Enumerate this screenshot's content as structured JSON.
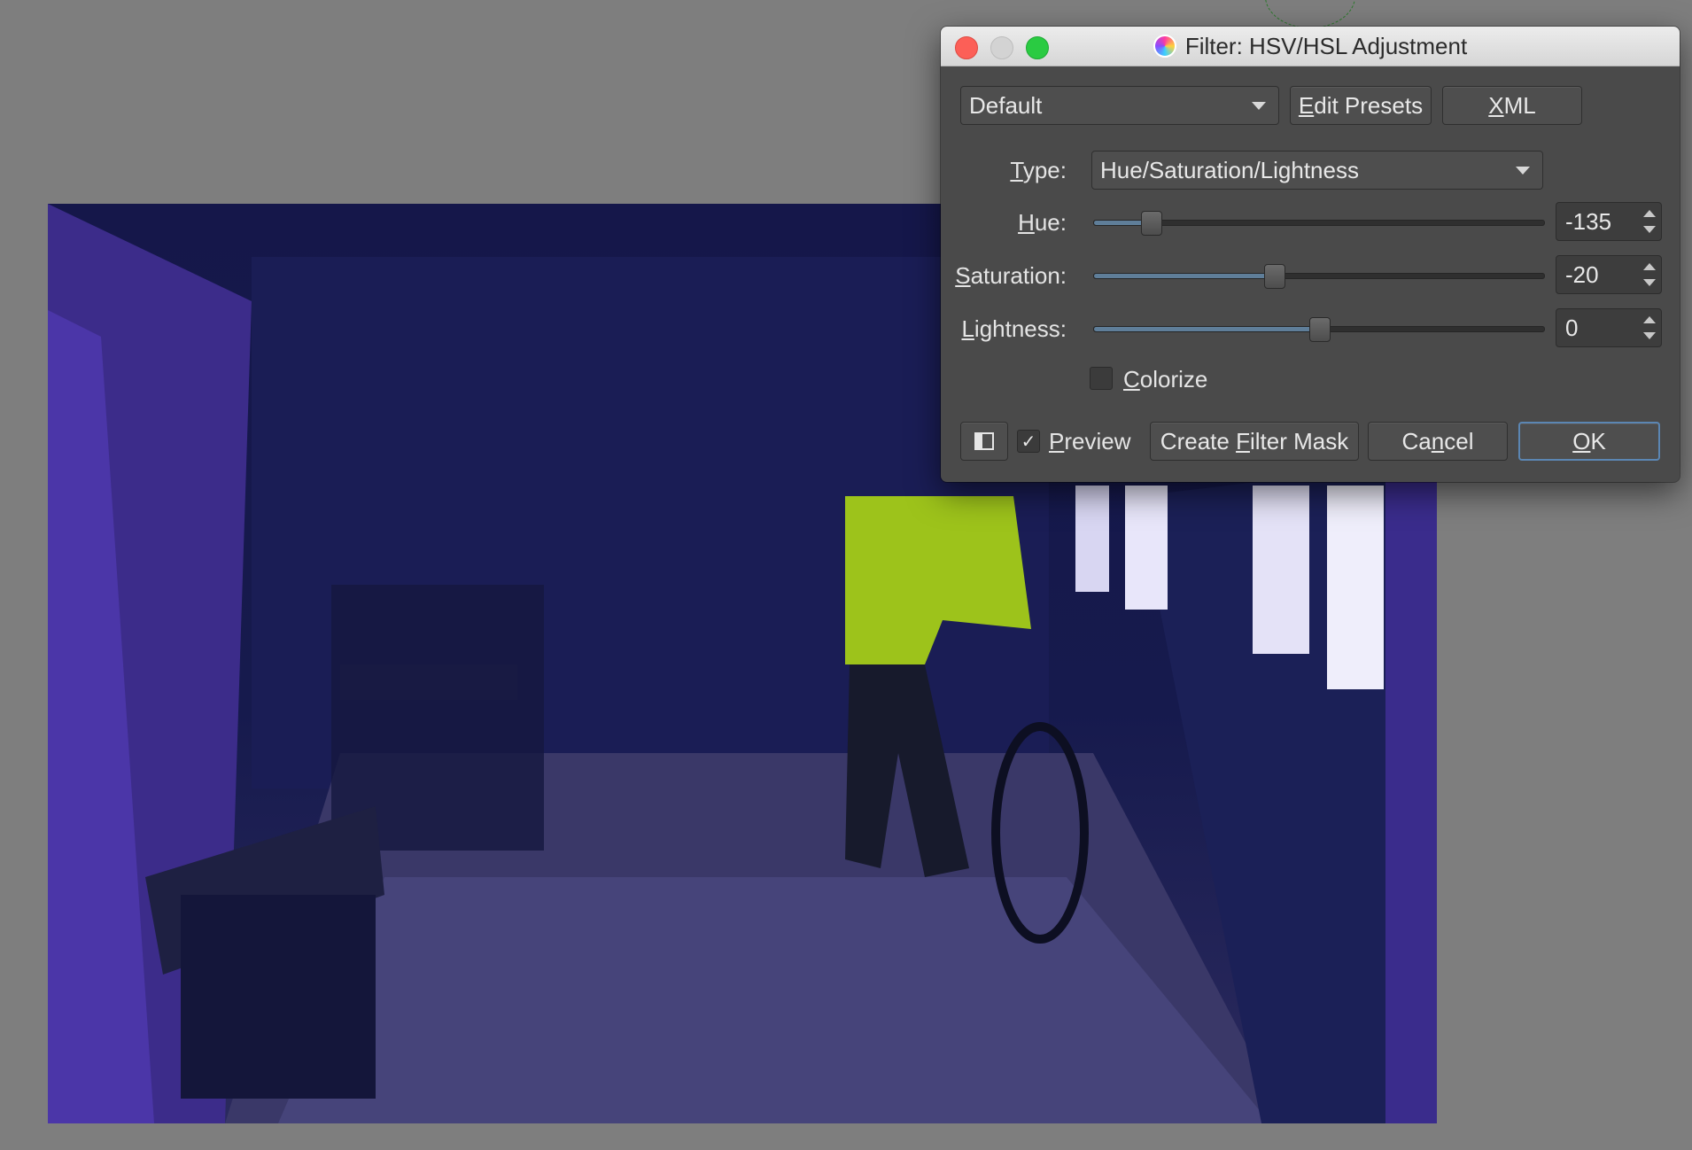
{
  "dialog": {
    "title": "Filter: HSV/HSL Adjustment",
    "icon": "krita-app-icon",
    "preset": {
      "selected": "Default"
    },
    "buttons": {
      "edit_presets_pre": "",
      "edit_presets_u": "E",
      "edit_presets_post": "dit Presets",
      "xml_u": "X",
      "xml_post": "ML"
    },
    "type": {
      "label_u": "T",
      "label_post": "ype:",
      "selected": "Hue/Saturation/Lightness"
    },
    "hue": {
      "label_u": "H",
      "label_post": "ue:",
      "value": "-135",
      "fraction": 0.125
    },
    "saturation": {
      "label_u": "S",
      "label_post": "aturation:",
      "value": "-20",
      "fraction": 0.4
    },
    "lightness": {
      "label_u": "L",
      "label_post": "ightness:",
      "value": "0",
      "fraction": 0.5
    },
    "colorize": {
      "label_u": "C",
      "label_post": "olorize",
      "checked": false
    },
    "footer": {
      "preview_u": "P",
      "preview_post": "review",
      "preview_checked": true,
      "create_mask_pre": "Create ",
      "create_mask_u": "F",
      "create_mask_post": "ilter Mask",
      "cancel_pre": "Ca",
      "cancel_u": "n",
      "cancel_post": "cel",
      "ok_u": "O",
      "ok_post": "K",
      "check_glyph": "✓"
    }
  },
  "colors": {
    "dialog_bg": "#4a4a4a",
    "slider_fill": "#5f7e99",
    "ok_border": "#5b86b3"
  }
}
